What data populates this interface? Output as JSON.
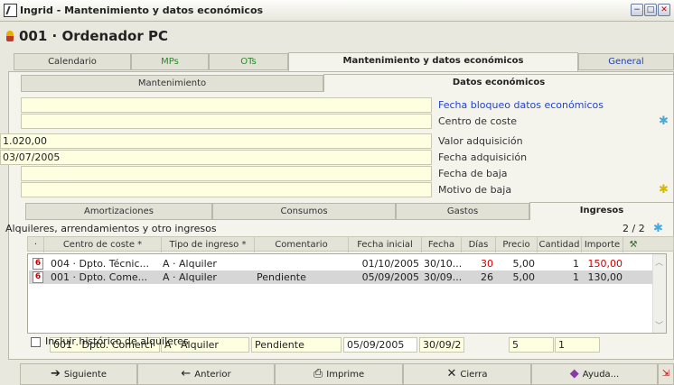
{
  "window": {
    "title": "Ingrid - Mantenimiento y datos económicos",
    "min": "−",
    "max": "□",
    "close": "✕"
  },
  "header": {
    "title": "001 · Ordenador PC"
  },
  "main_tabs": [
    "Calendario",
    "MPs",
    "OTs",
    "Mantenimiento y datos económicos",
    "General"
  ],
  "sub_tabs": [
    "Mantenimiento",
    "Datos económicos"
  ],
  "fields": [
    {
      "value": "",
      "label": "Fecha bloqueo datos económicos"
    },
    {
      "value": "",
      "label": "Centro de coste"
    },
    {
      "value": "1.020,00",
      "label": "Valor adquisición"
    },
    {
      "value": "03/07/2005",
      "label": "Fecha adquisición"
    },
    {
      "value": "",
      "label": "Fecha de baja"
    },
    {
      "value": "",
      "label": "Motivo de baja"
    }
  ],
  "bottom_tabs": [
    "Amortizaciones",
    "Consumos",
    "Gastos",
    "Ingresos"
  ],
  "section": {
    "title": "Alquileres, arrendamientos y otro ingresos",
    "pager": "2 / 2"
  },
  "columns": [
    "·",
    "Centro de coste *",
    "Tipo de ingreso *",
    "Comentario",
    "Fecha inicial",
    "Fecha f...",
    "Días",
    "Precio",
    "Cantidad",
    "Importe"
  ],
  "rows": [
    {
      "icon": "6",
      "centro": "004 · Dpto. Técnic...",
      "tipo": "A · Alquiler",
      "comentario": "",
      "fini": "01/10/2005",
      "ffin": "30/10...",
      "dias": "30",
      "precio": "5,00",
      "cantidad": "1",
      "importe": "150,00"
    },
    {
      "icon": "6",
      "centro": "001 · Dpto. Come...",
      "tipo": "A · Alquiler",
      "comentario": "Pendiente",
      "fini": "05/09/2005",
      "ffin": "30/09...",
      "dias": "26",
      "precio": "5,00",
      "cantidad": "1",
      "importe": "130,00"
    }
  ],
  "edit_row": {
    "centro": "001 · Dpto. Comerci",
    "tipo": "A · Alquiler",
    "comentario": "Pendiente",
    "fini": "05/09/2005",
    "ffin": "30/09/2",
    "precio": "5",
    "cantidad": "1"
  },
  "checkbox": {
    "label": "Incluir histórico de alquileres",
    "checked": false
  },
  "buttons": [
    {
      "label": "Siguiente",
      "icon": "➔"
    },
    {
      "label": "Anterior",
      "icon": "←"
    },
    {
      "label": "Imprime",
      "icon": "⎙"
    },
    {
      "label": "Cierra",
      "icon": "✕"
    },
    {
      "label": "Ayuda...",
      "icon": "◆"
    }
  ],
  "colors": {
    "field_bg": "#fefee0",
    "label_blue": "#2244cc",
    "red_value": "#d00000",
    "tab_green": "#2a8a2a"
  }
}
